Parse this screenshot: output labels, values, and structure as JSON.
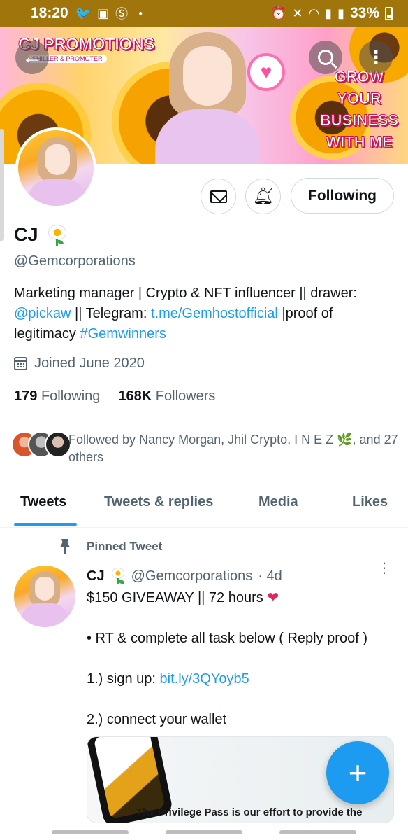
{
  "status_bar": {
    "time": "18:20",
    "battery": "33%"
  },
  "banner": {
    "title": "CJ PROMOTIONS",
    "subtitle": "SHILLER & PROMOTER",
    "tagline_lines": [
      "GROW",
      "YOUR",
      "BUSINESS",
      "WITH ME"
    ]
  },
  "profile": {
    "name": "CJ",
    "handle": "@Gemcorporations",
    "follow_button": "Following",
    "bio": {
      "text1": "Marketing manager | Crypto & NFT influencer || drawer: ",
      "link1": "@pickaw",
      "text2": " || Telegram: ",
      "link2": "t.me/Gemhostofficial",
      "text3": " |proof of legitimacy ",
      "link3": "#Gemwinners"
    },
    "joined": "Joined June 2020",
    "following_count": "179",
    "following_label": "Following",
    "followers_count": "168K",
    "followers_label": "Followers",
    "followed_by": "Followed by Nancy Morgan, Jhil Crypto, I N E Z 🌿, and 27 others"
  },
  "tabs": [
    {
      "label": "Tweets"
    },
    {
      "label": "Tweets & replies"
    },
    {
      "label": "Media"
    },
    {
      "label": "Likes"
    }
  ],
  "pinned_tweet": {
    "pinned_label": "Pinned Tweet",
    "name": "CJ",
    "handle": "@Gemcorporations",
    "time": "· 4d",
    "line1": "$150 GIVEAWAY || 72 hours",
    "line2": "• RT & complete all task below ( Reply proof )",
    "line3_prefix": "1.) sign up: ",
    "line3_link": "bit.ly/3QYoyb5",
    "line4": "2.) connect your wallet",
    "media_caption": "The Privilege Pass is our effort to provide the"
  },
  "fab": {
    "label": "+"
  },
  "colors": {
    "accent": "#1d9bf0",
    "status_bar": "#a0750c",
    "secondary_text": "#536471",
    "heart": "#e0245e"
  },
  "icons": [
    "back-arrow-icon",
    "search-icon",
    "more-vert-icon",
    "mail-icon",
    "bell-icon",
    "calendar-icon",
    "pin-icon",
    "compose-plus-icon"
  ]
}
